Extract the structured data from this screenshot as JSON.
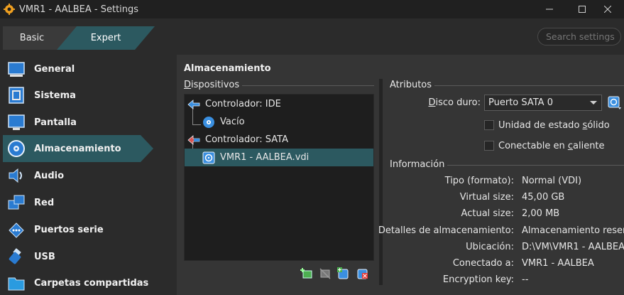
{
  "window": {
    "title": "VMR1 - AALBEA - Settings",
    "controls": [
      "minimize",
      "maximize",
      "close"
    ]
  },
  "mode_tabs": {
    "basic": "Basic",
    "expert": "Expert",
    "active": "Expert"
  },
  "search": {
    "placeholder": "Search settings"
  },
  "sidebar": {
    "items": [
      {
        "label": "General",
        "icon": "general-icon"
      },
      {
        "label": "Sistema",
        "icon": "system-icon"
      },
      {
        "label": "Pantalla",
        "icon": "display-icon"
      },
      {
        "label": "Almacenamiento",
        "icon": "storage-icon",
        "active": true
      },
      {
        "label": "Audio",
        "icon": "audio-icon"
      },
      {
        "label": "Red",
        "icon": "network-icon"
      },
      {
        "label": "Puertos serie",
        "icon": "serial-ports-icon"
      },
      {
        "label": "USB",
        "icon": "usb-icon"
      },
      {
        "label": "Carpetas compartidas",
        "icon": "shared-folders-icon"
      }
    ]
  },
  "page": {
    "title": "Almacenamiento",
    "devices_group": "Dispositivos",
    "tree": {
      "controller_ide": "Controlador: IDE",
      "ide_child": "Vacío",
      "controller_sata": "Controlador: SATA",
      "sata_child": "VMR1 - AALBEA.vdi"
    },
    "toolbar": [
      "add-controller-icon",
      "remove-controller-icon",
      "add-attachment-icon",
      "remove-attachment-icon"
    ],
    "attributes_group": "Atributos",
    "disk_label": "Disco duro:",
    "disk_value": "Puerto SATA 0",
    "ssd_label": "Unidad de estado sólido",
    "hotplug_label": "Conectable en caliente",
    "info_group": "Información",
    "info": [
      {
        "label": "Tipo (formato):",
        "value": "Normal (VDI)"
      },
      {
        "label": "Virtual size:",
        "value": "45,00 GB"
      },
      {
        "label": "Actual size:",
        "value": "2,00 MB"
      },
      {
        "label": "Detalles de almacenamiento:",
        "value": "Almacenamiento reserv..."
      },
      {
        "label": "Ubicación:",
        "value": "D:\\VM\\VMR1 - AALBEA..."
      },
      {
        "label": "Conectado a:",
        "value": "VMR1 - AALBEA"
      },
      {
        "label": "Encryption key:",
        "value": "--"
      }
    ]
  },
  "colors": {
    "accent": "#2c5960",
    "background": "#2b2b2b",
    "panel": "#353535",
    "tree_bg": "#1e1e1e"
  }
}
